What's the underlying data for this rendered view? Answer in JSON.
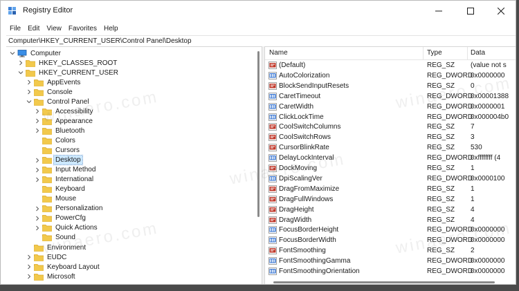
{
  "window": {
    "title": "Registry Editor"
  },
  "menu": [
    "File",
    "Edit",
    "View",
    "Favorites",
    "Help"
  ],
  "address": "Computer\\HKEY_CURRENT_USER\\Control Panel\\Desktop",
  "tree": [
    {
      "label": "Computer",
      "level": 0,
      "expanded": true,
      "type": "computer"
    },
    {
      "label": "HKEY_CLASSES_ROOT",
      "level": 1,
      "expanded": false
    },
    {
      "label": "HKEY_CURRENT_USER",
      "level": 1,
      "expanded": true
    },
    {
      "label": "AppEvents",
      "level": 2,
      "expanded": false
    },
    {
      "label": "Console",
      "level": 2,
      "expanded": false
    },
    {
      "label": "Control Panel",
      "level": 2,
      "expanded": true
    },
    {
      "label": "Accessibility",
      "level": 3,
      "expanded": false
    },
    {
      "label": "Appearance",
      "level": 3,
      "expanded": false
    },
    {
      "label": "Bluetooth",
      "level": 3,
      "expanded": false
    },
    {
      "label": "Colors",
      "level": 3,
      "leaf": true
    },
    {
      "label": "Cursors",
      "level": 3,
      "leaf": true
    },
    {
      "label": "Desktop",
      "level": 3,
      "expanded": false,
      "selected": true
    },
    {
      "label": "Input Method",
      "level": 3,
      "expanded": false
    },
    {
      "label": "International",
      "level": 3,
      "expanded": false
    },
    {
      "label": "Keyboard",
      "level": 3,
      "leaf": true
    },
    {
      "label": "Mouse",
      "level": 3,
      "leaf": true
    },
    {
      "label": "Personalization",
      "level": 3,
      "expanded": false
    },
    {
      "label": "PowerCfg",
      "level": 3,
      "expanded": false
    },
    {
      "label": "Quick Actions",
      "level": 3,
      "expanded": false
    },
    {
      "label": "Sound",
      "level": 3,
      "leaf": true
    },
    {
      "label": "Environment",
      "level": 2,
      "leaf": true
    },
    {
      "label": "EUDC",
      "level": 2,
      "expanded": false
    },
    {
      "label": "Keyboard Layout",
      "level": 2,
      "expanded": false
    },
    {
      "label": "Microsoft",
      "level": 2,
      "expanded": false
    }
  ],
  "columns": {
    "name": "Name",
    "type": "Type",
    "data": "Data"
  },
  "values": [
    {
      "name": "(Default)",
      "type": "REG_SZ",
      "data": "(value not s",
      "kind": "sz"
    },
    {
      "name": "AutoColorization",
      "type": "REG_DWORD",
      "data": "0x0000000",
      "kind": "dword"
    },
    {
      "name": "BlockSendInputResets",
      "type": "REG_SZ",
      "data": "0",
      "kind": "sz"
    },
    {
      "name": "CaretTimeout",
      "type": "REG_DWORD",
      "data": "0x00001388",
      "kind": "dword"
    },
    {
      "name": "CaretWidth",
      "type": "REG_DWORD",
      "data": "0x0000001",
      "kind": "dword"
    },
    {
      "name": "ClickLockTime",
      "type": "REG_DWORD",
      "data": "0x000004b0",
      "kind": "dword"
    },
    {
      "name": "CoolSwitchColumns",
      "type": "REG_SZ",
      "data": "7",
      "kind": "sz"
    },
    {
      "name": "CoolSwitchRows",
      "type": "REG_SZ",
      "data": "3",
      "kind": "sz"
    },
    {
      "name": "CursorBlinkRate",
      "type": "REG_SZ",
      "data": "530",
      "kind": "sz"
    },
    {
      "name": "DelayLockInterval",
      "type": "REG_DWORD",
      "data": "0xffffffff (4",
      "kind": "dword"
    },
    {
      "name": "DockMoving",
      "type": "REG_SZ",
      "data": "1",
      "kind": "sz"
    },
    {
      "name": "DpiScalingVer",
      "type": "REG_DWORD",
      "data": "0x0000100",
      "kind": "dword"
    },
    {
      "name": "DragFromMaximize",
      "type": "REG_SZ",
      "data": "1",
      "kind": "sz"
    },
    {
      "name": "DragFullWindows",
      "type": "REG_SZ",
      "data": "1",
      "kind": "sz"
    },
    {
      "name": "DragHeight",
      "type": "REG_SZ",
      "data": "4",
      "kind": "sz"
    },
    {
      "name": "DragWidth",
      "type": "REG_SZ",
      "data": "4",
      "kind": "sz"
    },
    {
      "name": "FocusBorderHeight",
      "type": "REG_DWORD",
      "data": "0x0000000",
      "kind": "dword"
    },
    {
      "name": "FocusBorderWidth",
      "type": "REG_DWORD",
      "data": "0x0000000",
      "kind": "dword"
    },
    {
      "name": "FontSmoothing",
      "type": "REG_SZ",
      "data": "2",
      "kind": "sz"
    },
    {
      "name": "FontSmoothingGamma",
      "type": "REG_DWORD",
      "data": "0x0000000",
      "kind": "dword"
    },
    {
      "name": "FontSmoothingOrientation",
      "type": "REG_DWORD",
      "data": "0x0000000",
      "kind": "dword"
    }
  ],
  "watermark": "winaero.com",
  "colors": {
    "folder": "#f2c94c",
    "folderDark": "#d9a520",
    "selection": "#cce8ff",
    "strIcon": "#c0392b",
    "binIcon": "#2e6fd1"
  },
  "icons": [
    "registry-editor-app-icon",
    "minimize-icon",
    "maximize-icon",
    "close-icon",
    "computer-icon",
    "folder-icon",
    "chevron-right-icon",
    "chevron-down-icon",
    "reg-sz-icon",
    "reg-dword-icon"
  ]
}
